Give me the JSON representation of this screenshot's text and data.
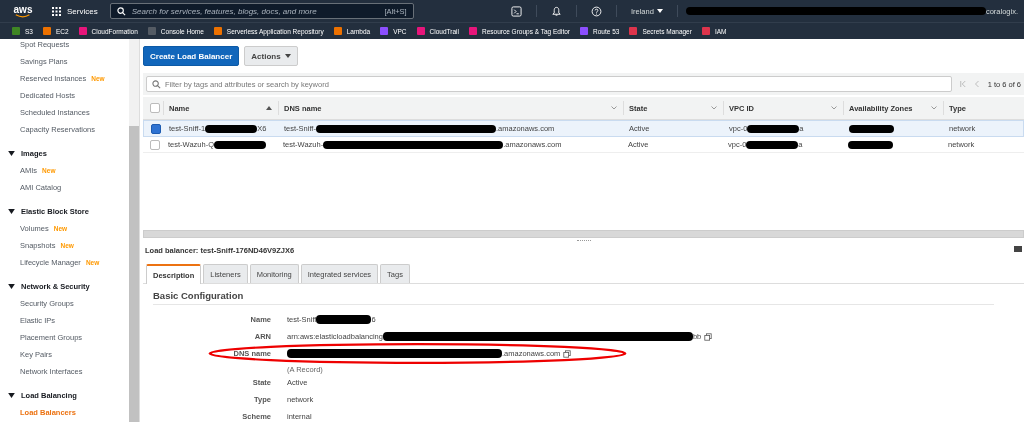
{
  "top_bar": {
    "logo": "aws",
    "services": "Services",
    "search": {
      "placeholder": "Search for services, features, blogs, docs, and more",
      "shortcut": "[Alt+S]"
    },
    "region": "Ireland",
    "account": [
      {
        "kind": "redacted"
      },
      {
        "kind": "text",
        "text": "coralogix."
      }
    ]
  },
  "favorites": [
    {
      "label": "S3",
      "color": "#3f8624"
    },
    {
      "label": "EC2",
      "color": "#ed7100"
    },
    {
      "label": "CloudFormation",
      "color": "#e7157b"
    },
    {
      "label": "Console Home",
      "color": "#545b64"
    },
    {
      "label": "Serverless Application Repository",
      "color": "#ed7100"
    },
    {
      "label": "Lambda",
      "color": "#ed7100"
    },
    {
      "label": "VPC",
      "color": "#8c4fff"
    },
    {
      "label": "CloudTrail",
      "color": "#e7157b"
    },
    {
      "label": "Resource Groups & Tag Editor",
      "color": "#e7157b"
    },
    {
      "label": "Route 53",
      "color": "#8c4fff"
    },
    {
      "label": "Secrets Manager",
      "color": "#dd344c"
    },
    {
      "label": "IAM",
      "color": "#dd344c"
    }
  ],
  "sidebar": {
    "groups": [
      {
        "items": [
          {
            "label": "Spot Requests",
            "selected": false
          },
          {
            "label": "Savings Plans",
            "selected": false
          },
          {
            "label": "Reserved Instances",
            "badge": "New",
            "selected": false
          },
          {
            "label": "Dedicated Hosts",
            "selected": false
          },
          {
            "label": "Scheduled Instances",
            "selected": false
          },
          {
            "label": "Capacity Reservations",
            "selected": false
          }
        ]
      },
      {
        "title": "Images",
        "expanded": true,
        "items": [
          {
            "label": "AMIs",
            "badge": "New",
            "selected": false
          },
          {
            "label": "AMI Catalog",
            "selected": false
          }
        ]
      },
      {
        "title": "Elastic Block Store",
        "expanded": true,
        "items": [
          {
            "label": "Volumes",
            "badge": "New",
            "selected": false
          },
          {
            "label": "Snapshots",
            "badge": "New",
            "selected": false
          },
          {
            "label": "Lifecycle Manager",
            "badge": "New",
            "selected": false
          }
        ]
      },
      {
        "title": "Network & Security",
        "expanded": true,
        "items": [
          {
            "label": "Security Groups",
            "selected": false
          },
          {
            "label": "Elastic IPs",
            "selected": false
          },
          {
            "label": "Placement Groups",
            "selected": false
          },
          {
            "label": "Key Pairs",
            "selected": false
          },
          {
            "label": "Network Interfaces",
            "selected": false
          }
        ]
      },
      {
        "title": "Load Balancing",
        "expanded": true,
        "items": [
          {
            "label": "Load Balancers",
            "selected": true
          }
        ]
      }
    ]
  },
  "toolbar": {
    "create_button": "Create Load Balancer",
    "actions_button": "Actions"
  },
  "filter": {
    "placeholder": "Filter by tags and attributes or search by keyword"
  },
  "pagination": "1 to 6 of 6",
  "table": {
    "all_selected": false,
    "columns": [
      {
        "label": "Name",
        "sorted": true
      },
      {
        "label": "DNS name",
        "sorted": false
      },
      {
        "label": "State",
        "sorted": false
      },
      {
        "label": "VPC ID",
        "sorted": false
      },
      {
        "label": "Availability Zones",
        "sorted": false
      },
      {
        "label": "Type",
        "sorted": false
      }
    ],
    "rows": [
      {
        "selected": true,
        "cells": [
          [
            {
              "kind": "text",
              "text": "test-Sniff-1"
            },
            {
              "kind": "redacted"
            },
            {
              "kind": "text",
              "text": "X6"
            }
          ],
          [
            {
              "kind": "text",
              "text": "test-Sniff-"
            },
            {
              "kind": "redacted"
            },
            {
              "kind": "text",
              "text": ".amazonaws.com"
            }
          ],
          [
            {
              "kind": "text",
              "text": "Active"
            }
          ],
          [
            {
              "kind": "text",
              "text": "vpc-0"
            },
            {
              "kind": "redacted"
            },
            {
              "kind": "text",
              "text": "a"
            }
          ],
          [
            {
              "kind": "redacted"
            }
          ],
          [
            {
              "kind": "text",
              "text": "network"
            }
          ]
        ]
      },
      {
        "selected": false,
        "cells": [
          [
            {
              "kind": "text",
              "text": "test-Wazuh-Q"
            },
            {
              "kind": "redacted"
            }
          ],
          [
            {
              "kind": "text",
              "text": "test-Wazuh-"
            },
            {
              "kind": "redacted"
            },
            {
              "kind": "text",
              "text": ".amazonaws.com"
            }
          ],
          [
            {
              "kind": "text",
              "text": "Active"
            }
          ],
          [
            {
              "kind": "text",
              "text": "vpc-0"
            },
            {
              "kind": "redacted"
            },
            {
              "kind": "text",
              "text": "a"
            }
          ],
          [
            {
              "kind": "redacted"
            }
          ],
          [
            {
              "kind": "text",
              "text": "network"
            }
          ]
        ]
      }
    ]
  },
  "detail": {
    "title": "Load balancer: test-Sniff-176ND46V9ZJX6",
    "tabs": [
      {
        "label": "Description",
        "selected": true
      },
      {
        "label": "Listeners",
        "selected": false
      },
      {
        "label": "Monitoring",
        "selected": false
      },
      {
        "label": "Integrated services",
        "selected": false
      },
      {
        "label": "Tags",
        "selected": false
      }
    ],
    "section": "Basic Configuration",
    "fields": [
      {
        "label": "Name",
        "value": [
          {
            "kind": "text",
            "text": "test-Sniff"
          },
          {
            "kind": "redacted"
          },
          {
            "kind": "text",
            "text": "6"
          }
        ]
      },
      {
        "label": "ARN",
        "copy": true,
        "value": [
          {
            "kind": "text",
            "text": "arn:aws:elasticloadbalancing"
          },
          {
            "kind": "redacted"
          },
          {
            "kind": "text",
            "text": "bb"
          }
        ]
      },
      {
        "label": "DNS name",
        "copy": true,
        "circled": true,
        "note": "(A Record)",
        "value": [
          {
            "kind": "redacted"
          },
          {
            "kind": "text",
            "text": ".amazonaws.com"
          }
        ]
      },
      {
        "label": "State",
        "value": [
          {
            "kind": "text",
            "text": "Active"
          }
        ]
      },
      {
        "label": "Type",
        "value": [
          {
            "kind": "text",
            "text": "network"
          }
        ]
      },
      {
        "label": "Scheme",
        "value": [
          {
            "kind": "text",
            "text": "internal"
          }
        ]
      }
    ]
  }
}
